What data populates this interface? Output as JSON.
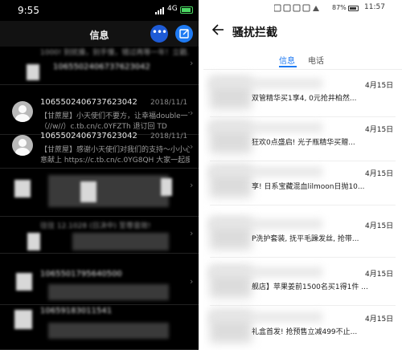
{
  "left_phone": {
    "status": {
      "time": "9:55",
      "network": "4G"
    },
    "title": "信息",
    "more_label": "•••",
    "threads": [
      {
        "sender": "",
        "date": "",
        "preview_line1": "1000! 别扰搡，别手慢，错过再等一年！立戳...",
        "preview_line2": ""
      },
      {
        "sender": "1065502406737623042",
        "date": "2018/11/1",
        "preview_line1": "【甘蔗屋】小天使们不要方，让幸福double一下",
        "preview_line2": "（//w//）c.tb.cn/c.0YFZTh 退订回 TD"
      },
      {
        "sender": "1065502406737623042",
        "date": "2018/11/1",
        "preview_line1": "【甘蔗屋】感谢小天使们对我们的支持～小小心",
        "preview_line2": "意献上 https://c.tb.cn/c.0YG8QH 大家一起度..."
      }
    ],
    "blurred_numbers": [
      "1065502406737623042",
      "1065501795640500",
      "10659183011541"
    ],
    "blurred_text": "往往 12.1028 (日决中) 至尊音效!"
  },
  "right_phone": {
    "status": {
      "battery": "87%",
      "time": "11:57"
    },
    "title": "骚扰拦截",
    "tabs": {
      "messages": "信息",
      "calls": "电话"
    },
    "items": [
      {
        "date": "4月15日",
        "text": "双管精华买1享4, 0元抢井柏然..."
      },
      {
        "date": "4月15日",
        "text": "狂欢0点盛启! 光子瓶精华买赠..."
      },
      {
        "date": "4月15日",
        "text": "享! 日系宝藏混血lilmoon日抛10..."
      },
      {
        "date": "4月15日",
        "text": "P洗护套装, 抚平毛躁发丝, 抢带..."
      },
      {
        "date": "4月15日",
        "text": "舰店】苹果姜前1500名买1得1件 ..."
      },
      {
        "date": "4月15日",
        "text": "礼盒首发! 抢预售立减499不止..."
      }
    ]
  }
}
